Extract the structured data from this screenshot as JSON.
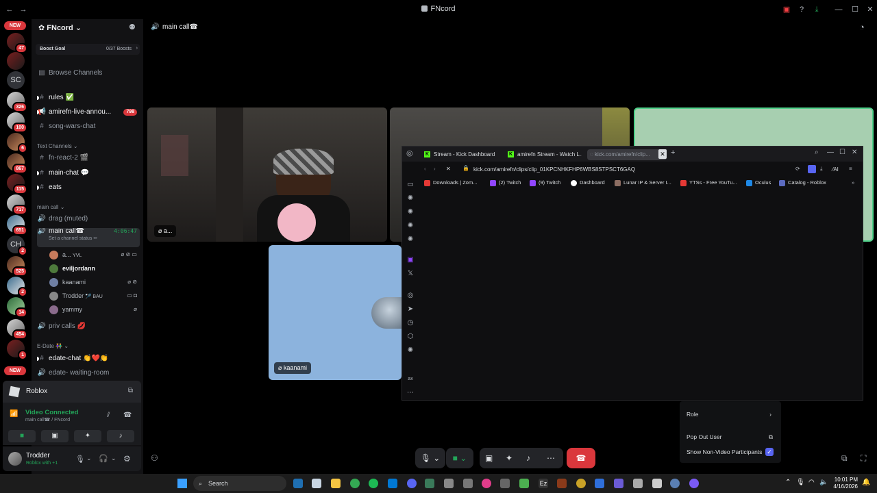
{
  "window": {
    "title": "FNcord"
  },
  "rail": {
    "new_badge_top": "NEW",
    "new_badge_bottom": "NEW",
    "items": [
      {
        "label": "",
        "badge": "47"
      },
      {
        "label": "",
        "badge": ""
      },
      {
        "label": "SC",
        "badge": ""
      },
      {
        "label": "",
        "badge": "326"
      },
      {
        "label": "",
        "badge": "100"
      },
      {
        "label": "",
        "badge": "6"
      },
      {
        "label": "",
        "badge": "867"
      },
      {
        "label": "",
        "badge": "115"
      },
      {
        "label": "",
        "badge": "717"
      },
      {
        "label": "",
        "badge": "651"
      },
      {
        "label": "CH",
        "badge": "2"
      },
      {
        "label": "",
        "badge": "525"
      },
      {
        "label": "",
        "badge": "2"
      },
      {
        "label": "",
        "badge": "14"
      },
      {
        "label": "",
        "badge": "454"
      },
      {
        "label": "",
        "badge": "1"
      }
    ]
  },
  "sidebar": {
    "server_name": "FNcord",
    "boost_goal": "Boost Goal",
    "boost_count": "0/37 Boosts",
    "browse": "Browse Channels",
    "channels_top": [
      {
        "name": "rules ✅",
        "icon": "#",
        "bright": true
      },
      {
        "name": "amirefn-live-annou...",
        "icon": "📢",
        "bright": true,
        "mention": "798"
      },
      {
        "name": "song-wars-chat",
        "icon": "#",
        "bright": false
      }
    ],
    "text_category": "Text Channels",
    "text_channels": [
      {
        "name": "fn-react-2 🎬",
        "icon": "#",
        "bright": false
      },
      {
        "name": "main-chat 💬",
        "icon": "#",
        "bright": true
      },
      {
        "name": "eats",
        "icon": "#",
        "bright": true
      }
    ],
    "voice_category": "main call",
    "voice_channels": [
      {
        "name": "drag (muted)",
        "icon": "🔊"
      },
      {
        "name": "main call☎",
        "icon": "🔊",
        "time": "4:06:47",
        "status": "Set a channel status ✏"
      }
    ],
    "voice_users": [
      {
        "name": "a...",
        "extra": "YVL"
      },
      {
        "name": "eviljordann",
        "extra": ""
      },
      {
        "name": "kaanami",
        "extra": ""
      },
      {
        "name": "Trodder",
        "extra": "🏸 BAU"
      },
      {
        "name": "yammy",
        "extra": ""
      }
    ],
    "priv_calls": "priv calls 💋",
    "edate_category": "E-Date 👫",
    "edate_channels": [
      {
        "name": "edate-chat 👏❤️👏",
        "icon": "#"
      },
      {
        "name": "edate- waiting-room",
        "icon": "🔊"
      }
    ]
  },
  "activity": {
    "game": "Roblox"
  },
  "voice_panel": {
    "status": "Video Connected",
    "location": "main call☎ / FNcord"
  },
  "user_panel": {
    "name": "Trodder",
    "status": "Roblox with +1"
  },
  "main": {
    "header": "main call☎",
    "tile1_name": "a...",
    "tile4_name": "kaanami"
  },
  "browser": {
    "tabs": [
      "Stream - Kick Dashboard",
      "amirefn Stream - Watch L...",
      "kick.com/amirefn/clip..."
    ],
    "url": "kick.com/amirefn/clips/clip_01KPCNHKFHP6WBS8STPSCT6GAQ",
    "bookmarks": [
      {
        "label": "Downloads | Zom...",
        "color": "#e53935"
      },
      {
        "label": "(2) Twitch",
        "color": "#9146ff"
      },
      {
        "label": "(9) Twitch",
        "color": "#9146ff"
      },
      {
        "label": "Dashboard",
        "color": "#ffffff"
      },
      {
        "label": "Lunar IP & Server I...",
        "color": "#8d6e63"
      },
      {
        "label": "YTSs - Free YouTu...",
        "color": "#e53935"
      },
      {
        "label": "Oculus",
        "color": "#1e88e5"
      },
      {
        "label": "Catalog - Roblox",
        "color": "#5c6bc0"
      }
    ],
    "ai_label": "AI"
  },
  "context_menu": {
    "role": "Role",
    "pop_out": "Pop Out User",
    "show_non_video": "Show Non-Video Participants"
  },
  "taskbar": {
    "search": "Search",
    "time": "10:01 PM",
    "date": "4/16/2026"
  }
}
